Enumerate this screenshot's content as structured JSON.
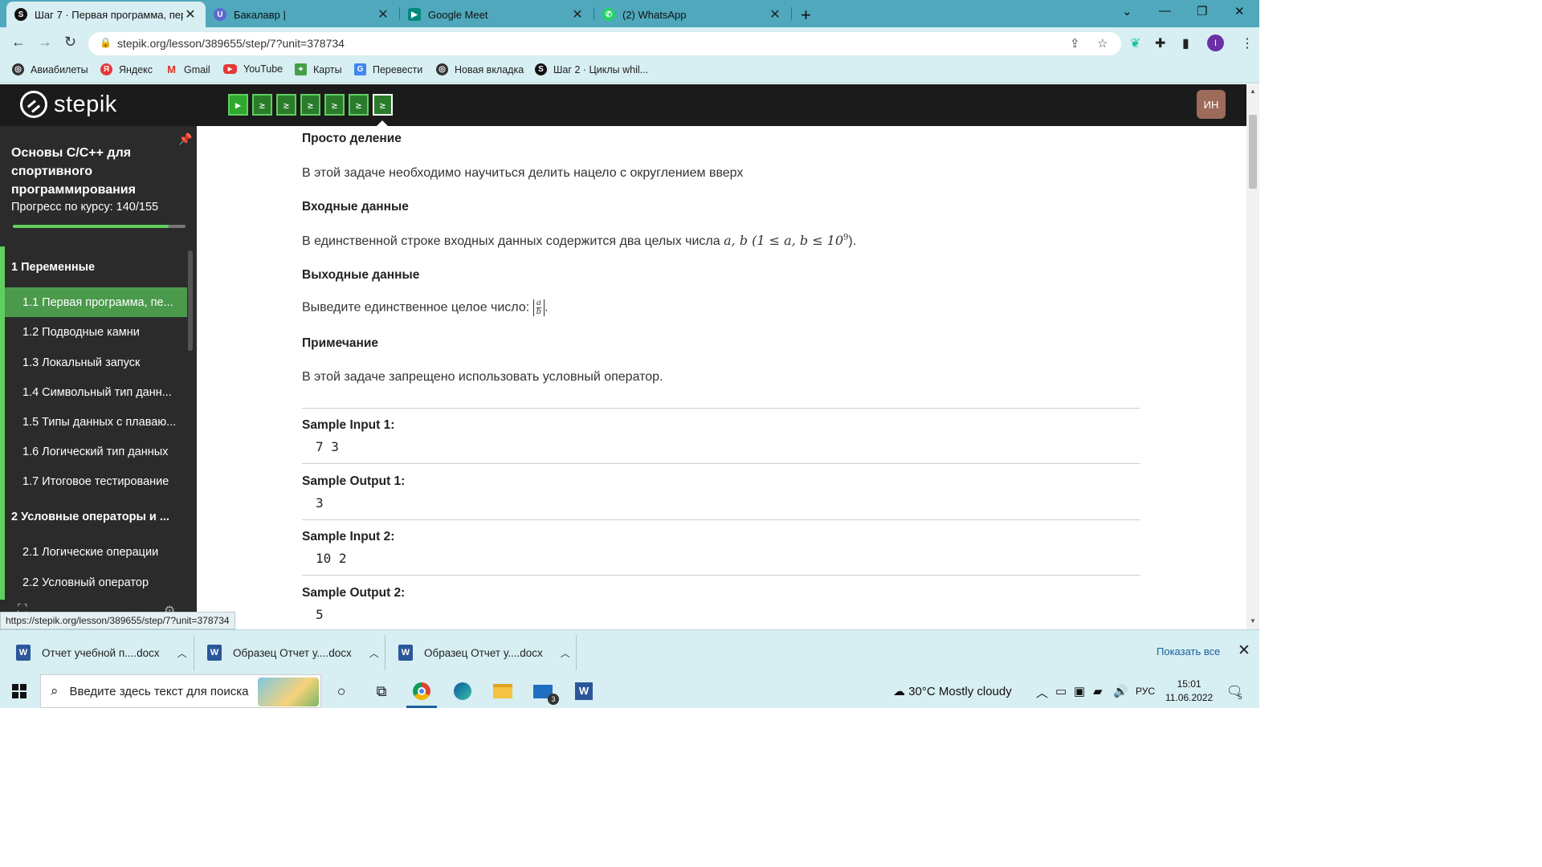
{
  "browser": {
    "tabs": [
      {
        "title": "Шаг 7 · Первая программа, пер",
        "icon": "stepik-icon",
        "active": true
      },
      {
        "title": "Бакалавр |",
        "icon": "u-icon",
        "active": false
      },
      {
        "title": "Google Meet",
        "icon": "google-meet-icon",
        "active": false
      },
      {
        "title": "(2) WhatsApp",
        "icon": "whatsapp-icon",
        "active": false
      }
    ],
    "close_glyph": "✕",
    "new_tab_glyph": "+",
    "url": "stepik.org/lesson/389655/step/7?unit=378734",
    "profile_initial": "I",
    "bookmarks": [
      {
        "label": "Авиабилеты",
        "icon": "globe-icon"
      },
      {
        "label": "Яндекс",
        "icon": "yandex-icon"
      },
      {
        "label": "Gmail",
        "icon": "gmail-icon"
      },
      {
        "label": "YouTube",
        "icon": "youtube-icon"
      },
      {
        "label": "Карты",
        "icon": "maps-icon"
      },
      {
        "label": "Перевести",
        "icon": "translate-icon"
      },
      {
        "label": "Новая вкладка",
        "icon": "globe-icon"
      },
      {
        "label": "Шаг 2 · Циклы whil...",
        "icon": "stepik-icon"
      }
    ]
  },
  "stepik": {
    "logo_text": "stepik",
    "user_initials": "ИН",
    "step_glyph": "▶",
    "code_glyph": "≥"
  },
  "sidebar": {
    "course_title": "Основы С/С++ для спортивного программирования",
    "progress_label": "Прогресс по курсу:  140/155",
    "progress_fraction": 0.903,
    "modules": [
      {
        "label": "1  Переменные"
      },
      {
        "label": "2  Условные операторы и ..."
      }
    ],
    "lessons": [
      {
        "label": "1.1   Первая программа, пе...",
        "active": true
      },
      {
        "label": "1.2  Подводные камни",
        "active": false
      },
      {
        "label": "1.3  Локальный запуск",
        "active": false
      },
      {
        "label": "1.4  Символьный тип данн...",
        "active": false
      },
      {
        "label": "1.5  Типы данных с плаваю...",
        "active": false
      },
      {
        "label": "1.6  Логический тип данных",
        "active": false
      },
      {
        "label": "1.7  Итоговое тестирование",
        "active": false
      },
      {
        "label": "2.1  Логические операции",
        "active": false
      },
      {
        "label": "2.2  Условный оператор",
        "active": false
      }
    ]
  },
  "problem": {
    "title": "Просто деление",
    "statement": "В этой задаче необходимо научиться делить нацело с округлением вверх",
    "input_heading": "Входные данные",
    "input_text": "В единственной строке входных данных содержится два целых числа ",
    "input_math": "a, b (1 ≤ a, b ≤ 10",
    "input_math_exp": "9",
    "input_math_end": ").",
    "output_heading": "Выходные данные",
    "output_text": "Выведите единственное целое число: ",
    "frac_num": "a",
    "frac_den": "b",
    "output_end": ".",
    "note_heading": "Примечание",
    "note_text": "В этой задаче запрещено использовать условный оператор.",
    "samples": [
      {
        "label": "Sample Input 1:",
        "value": "7 3"
      },
      {
        "label": "Sample Output 1:",
        "value": "3"
      },
      {
        "label": "Sample Input 2:",
        "value": "10 2"
      },
      {
        "label": "Sample Output 2:",
        "value": "5"
      }
    ]
  },
  "status_url": "https://stepik.org/lesson/389655/step/7?unit=378734",
  "downloads": {
    "items": [
      {
        "name": "Отчет учебной п....docx"
      },
      {
        "name": "Образец Отчет у....docx"
      },
      {
        "name": "Образец Отчет у....docx"
      }
    ],
    "show_all": "Показать все"
  },
  "taskbar": {
    "search_placeholder": "Введите здесь текст для поиска",
    "mail_badge": "3",
    "weather": "30°C  Mostly cloudy",
    "language": "РУС",
    "time": "15:01",
    "date": "11.06.2022",
    "notification_count": "5"
  }
}
